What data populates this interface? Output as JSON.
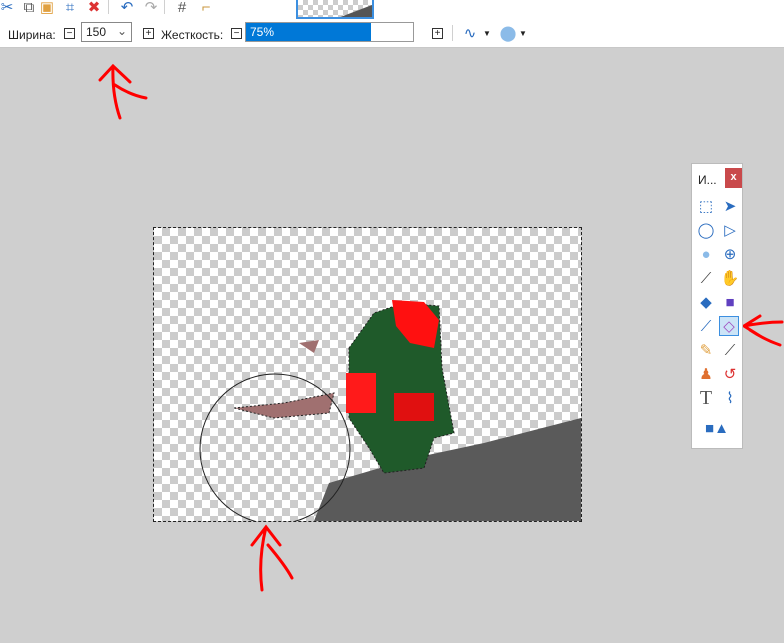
{
  "toolbar": {
    "width_label": "Ширина:",
    "width_value": "150",
    "hardness_label": "Жесткость:",
    "hardness_value": "75%",
    "hardness_percent": 75,
    "minus": "⊟",
    "plus": "⊞"
  },
  "tools_window": {
    "title": "И...",
    "close": "x",
    "tools": [
      "rectangle-select",
      "move-selection",
      "lasso-select",
      "move-selection-only",
      "ellipse-select",
      "zoom",
      "magic-wand",
      "pan",
      "paint-bucket",
      "gradient",
      "paintbrush",
      "eraser",
      "pencil",
      "color-picker",
      "clone-stamp",
      "recolor",
      "text",
      "line-curve",
      "shapes"
    ],
    "active": "eraser"
  },
  "colors": {
    "accent": "#0078d7",
    "close": "#c9494b",
    "annotation": "#ff0000"
  }
}
